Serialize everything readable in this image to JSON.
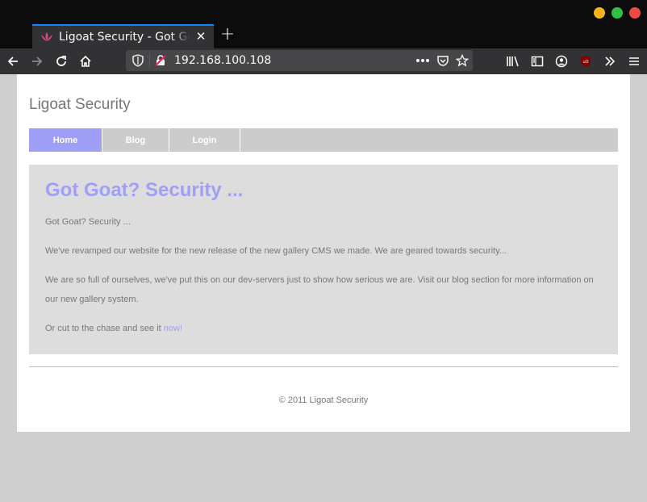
{
  "browser": {
    "tab_title": "Ligoat Security - Got Goat? Security ...",
    "url": "192.168.100.108",
    "icons": {
      "tab_favicon": "lotus-icon",
      "tab_close": "close-icon",
      "new_tab": "plus-icon",
      "back": "back-arrow-icon",
      "forward": "forward-arrow-icon",
      "reload": "reload-icon",
      "home": "home-icon",
      "tracking": "shield-icon",
      "insecure": "insecure-lock-icon",
      "page_actions": "more-dots-icon",
      "pocket": "pocket-icon",
      "bookmark": "star-icon",
      "library": "library-icon",
      "sidebar": "sidebar-icon",
      "account": "account-icon",
      "ublock": "ublock-icon",
      "overflow": "chevrons-right-icon",
      "menu": "hamburger-menu-icon"
    }
  },
  "site": {
    "title": "Ligoat Security",
    "menu": [
      {
        "label": "Home",
        "active": true
      },
      {
        "label": "Blog",
        "active": false
      },
      {
        "label": "Login",
        "active": false
      }
    ],
    "content": {
      "heading": "Got Goat? Security ...",
      "paragraphs": [
        "Got Goat? Security ...",
        "We've revamped our website for the new release of the new gallery CMS we made. We are geared towards security...",
        "We are so full of ourselves, we've put this on our dev-servers just to show how serious we are. Visit our blog section for more information on our new gallery system."
      ],
      "cta_text": "Or cut to the chase and see it ",
      "cta_link": "now!"
    },
    "footer": "© 2011 Ligoat Security"
  },
  "colors": {
    "accent": "#9f9ff7",
    "menu_bg": "#cccccc",
    "content_bg": "#dddddd",
    "text": "#777777",
    "chrome_dark": "#0c0c0d",
    "toolbar": "#323234",
    "tab_highlight": "#0a84ff"
  }
}
